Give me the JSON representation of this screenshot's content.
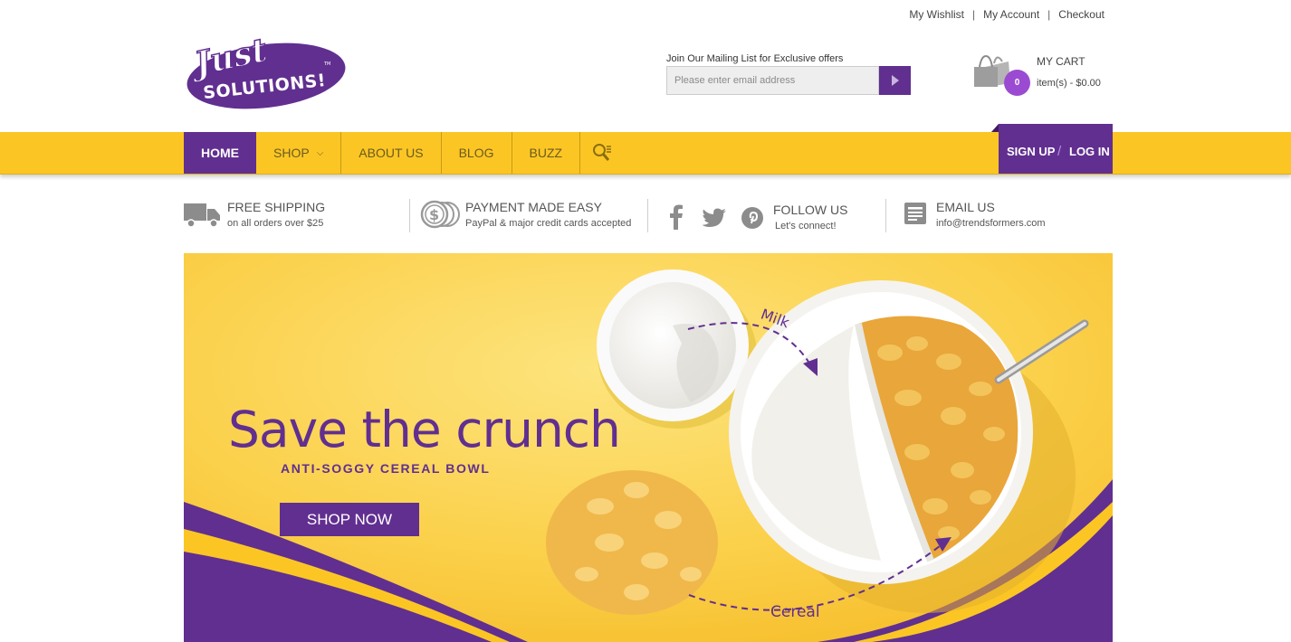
{
  "top_links": {
    "wishlist": "My Wishlist",
    "account": "My Account",
    "checkout": "Checkout",
    "separator": "|"
  },
  "logo": {
    "line1": "Just",
    "line2": "SOLUTIONS!",
    "tm": "TM"
  },
  "mailing": {
    "label": "Join Our Mailing List for Exclusive offers",
    "placeholder": "Please enter email address"
  },
  "cart": {
    "title": "MY CART",
    "count": "0",
    "summary": "item(s) - $0.00"
  },
  "nav": {
    "items": [
      "HOME",
      "SHOP",
      "ABOUT US",
      "BLOG",
      "BUZZ"
    ],
    "active": "HOME",
    "sign_up": "SIGN UP",
    "divider": "/",
    "log_in": "LOG IN"
  },
  "info": {
    "shipping": {
      "title": "FREE SHIPPING",
      "sub": "on all orders over $25"
    },
    "payment": {
      "title": "PAYMENT MADE EASY",
      "sub": "PayPal & major credit cards accepted"
    },
    "follow": {
      "title": "FOLLOW US",
      "sub": "Let's connect!"
    },
    "email": {
      "title": "EMAIL US",
      "sub": "info@trendsformers.com"
    }
  },
  "banner": {
    "headline": "Save the crunch",
    "subhead": "ANTI-SOGGY CEREAL BOWL",
    "cta": "SHOP NOW",
    "label_milk": "Milk",
    "label_cereal": "Cereal"
  },
  "colors": {
    "purple": "#612f90",
    "yellow": "#fbc624",
    "badge": "#9b4bd1"
  },
  "icons": [
    "truck-icon",
    "coins-icon",
    "facebook-icon",
    "twitter-icon",
    "pinterest-icon",
    "newsletter-icon",
    "search-icon",
    "cart-bags-icon",
    "play-arrow-icon",
    "chevron-down-icon"
  ]
}
